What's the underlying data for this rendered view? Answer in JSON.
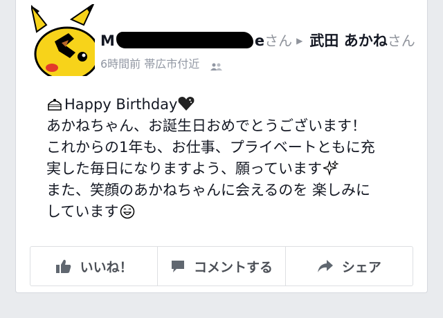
{
  "post": {
    "author_visible_prefix": "M",
    "author_visible_suffix": "e",
    "author_suffix": "さん",
    "target_name": "武田 あかね",
    "target_suffix": "さん",
    "time": "6時間前",
    "location": "帯広市付近",
    "audience_icon": "friends-icon"
  },
  "message": {
    "line1": "Happy Birthday",
    "line2": "あかねちゃん、お誕生日おめでとうございます！",
    "line3": "これからの1年も、お仕事、プライベートともに充",
    "line4": "実した毎日になりますよう、願っています",
    "line5": "また、笑顔のあかねちゃんに会えるのを 楽しみに",
    "line6": "しています"
  },
  "actions": {
    "like": "いいね！",
    "comment": "コメントする",
    "share": "シェア"
  },
  "colors": {
    "background": "#e9ebee",
    "card": "#ffffff",
    "text": "#141823",
    "meta": "#9197a3",
    "action_text": "#4b4f56"
  }
}
